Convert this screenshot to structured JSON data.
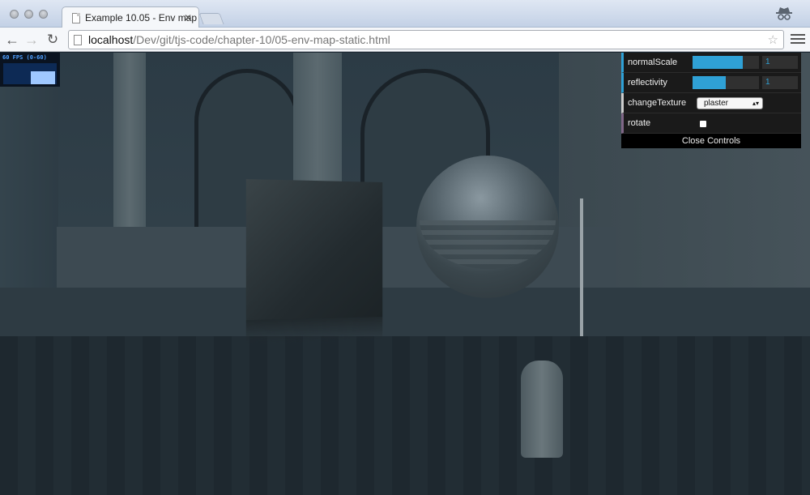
{
  "browser": {
    "tab_title": "Example 10.05 - Env map",
    "tab_close": "✕",
    "url_host": "localhost",
    "url_path": "/Dev/git/tjs-code/chapter-10/05-env-map-static.html",
    "back_glyph": "←",
    "forward_glyph": "→",
    "reload_glyph": "↻",
    "star_glyph": "☆"
  },
  "stats": {
    "fps_text": "60 FPS (0-60)",
    "graph_fill": 0.6
  },
  "controls": {
    "normalScale": {
      "label": "normalScale",
      "value": "1",
      "fill": 0.75
    },
    "reflectivity": {
      "label": "reflectivity",
      "value": "1",
      "fill": 0.5
    },
    "changeTexture": {
      "label": "changeTexture",
      "selected": "plaster",
      "arrow": "▴▾"
    },
    "rotate": {
      "label": "rotate",
      "checked": false
    },
    "close_label": "Close Controls"
  },
  "colors": {
    "accent": "#2fa1d6",
    "panel_bg": "#1a1a1a",
    "titlebar": "#c3d1e6"
  },
  "icons": {
    "page": "page-icon",
    "incognito": "incognito-icon",
    "menu": "hamburger-menu-icon"
  }
}
